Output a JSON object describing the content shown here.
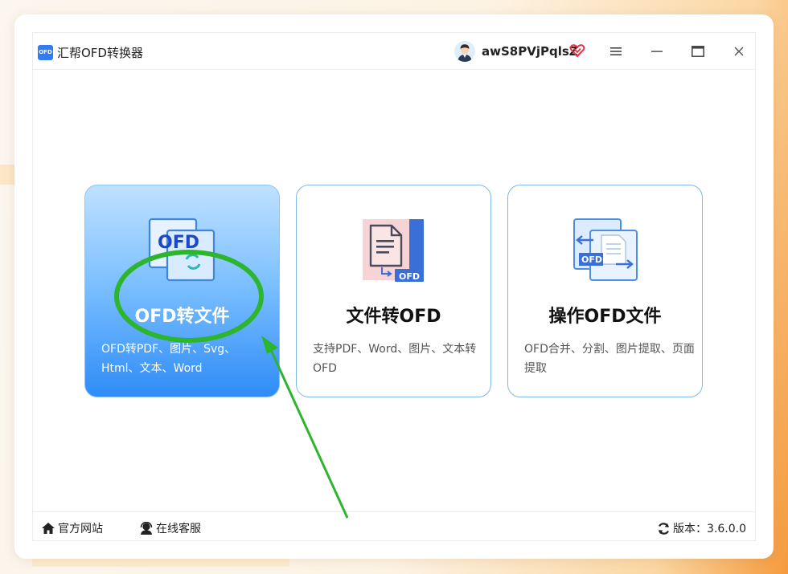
{
  "app": {
    "logo_text": "OFD",
    "title": "汇帮OFD转换器"
  },
  "user": {
    "name": "awS8PVjPqlsZ"
  },
  "cards": [
    {
      "title": "OFD转文件",
      "desc": "OFD转PDF、图片、Svg、Html、文本、Word",
      "icon_text": "OFD",
      "selected": true
    },
    {
      "title": "文件转OFD",
      "desc": "支持PDF、Word、图片、文本转OFD",
      "icon_text": "OFD",
      "selected": false
    },
    {
      "title": "操作OFD文件",
      "desc": "OFD合并、分割、图片提取、页面提取",
      "icon_text": "OFD",
      "selected": false
    }
  ],
  "footer": {
    "site_label": "官方网站",
    "service_label": "在线客服",
    "version_label": "版本：3.6.0.0"
  },
  "colors": {
    "accent": "#2f8cf7",
    "card_border": "#7fb7ef",
    "annotation": "#2db52d",
    "vip": "#e8334a"
  }
}
